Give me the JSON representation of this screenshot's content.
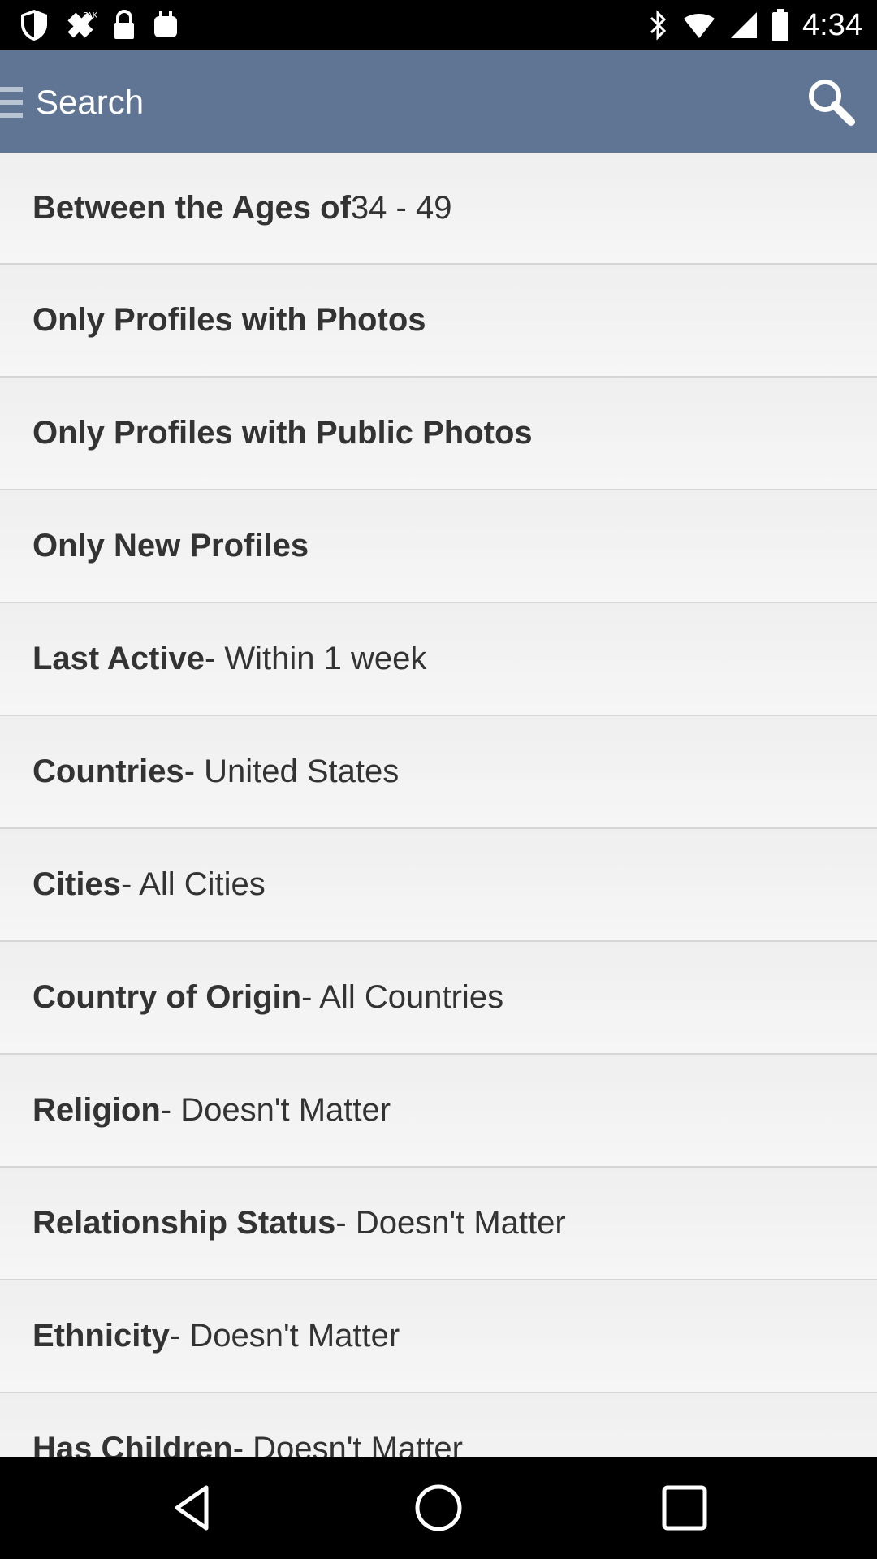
{
  "status_bar": {
    "time": "4:34",
    "icons": [
      "shield-icon",
      "fake-gps-icon",
      "lock-icon",
      "briefcase-icon",
      "bluetooth-icon",
      "wifi-icon",
      "signal-icon",
      "battery-icon"
    ]
  },
  "app_bar": {
    "title": "Search",
    "search_icon": "search-icon",
    "menu_icon": "menu-icon"
  },
  "rows": [
    {
      "label": "Between the Ages of",
      "value": " 34 - 49"
    },
    {
      "label": "Only Profiles with Photos",
      "value": ""
    },
    {
      "label": "Only Profiles with Public Photos",
      "value": ""
    },
    {
      "label": "Only New Profiles",
      "value": ""
    },
    {
      "label": "Last Active",
      "value": " - Within 1 week"
    },
    {
      "label": "Countries",
      "value": " - United States"
    },
    {
      "label": "Cities",
      "value": " - All Cities"
    },
    {
      "label": "Country of Origin",
      "value": " - All Countries"
    },
    {
      "label": "Religion",
      "value": " - Doesn't Matter"
    },
    {
      "label": "Relationship Status",
      "value": " - Doesn't Matter"
    },
    {
      "label": "Ethnicity",
      "value": " - Doesn't Matter"
    },
    {
      "label": "Has Children",
      "value": " - Doesn't Matter"
    }
  ],
  "nav_bar": {
    "icons": [
      "back-icon",
      "home-icon",
      "recents-icon"
    ]
  },
  "colors": {
    "app_bar": "#5f7593",
    "background": "#f2f2f2",
    "text": "#333333"
  }
}
